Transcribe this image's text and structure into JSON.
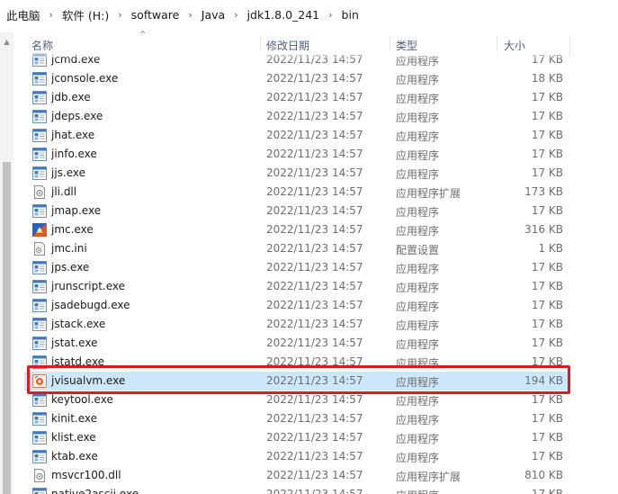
{
  "breadcrumb": [
    "此电脑",
    "软件 (H:)",
    "software",
    "Java",
    "jdk1.8.0_241",
    "bin"
  ],
  "columns": {
    "name": "名称",
    "modified": "修改日期",
    "type": "类型",
    "size": "大小"
  },
  "files": [
    {
      "name": "jcmd.exe",
      "date": "2022/11/23 14:57",
      "type": "应用程序",
      "size": "17 KB",
      "icon": "exe-icon"
    },
    {
      "name": "jconsole.exe",
      "date": "2022/11/23 14:57",
      "type": "应用程序",
      "size": "18 KB",
      "icon": "exe-icon"
    },
    {
      "name": "jdb.exe",
      "date": "2022/11/23 14:57",
      "type": "应用程序",
      "size": "17 KB",
      "icon": "exe-icon"
    },
    {
      "name": "jdeps.exe",
      "date": "2022/11/23 14:57",
      "type": "应用程序",
      "size": "17 KB",
      "icon": "exe-icon"
    },
    {
      "name": "jhat.exe",
      "date": "2022/11/23 14:57",
      "type": "应用程序",
      "size": "17 KB",
      "icon": "exe-icon"
    },
    {
      "name": "jinfo.exe",
      "date": "2022/11/23 14:57",
      "type": "应用程序",
      "size": "17 KB",
      "icon": "exe-icon"
    },
    {
      "name": "jjs.exe",
      "date": "2022/11/23 14:57",
      "type": "应用程序",
      "size": "17 KB",
      "icon": "exe-icon"
    },
    {
      "name": "jli.dll",
      "date": "2022/11/23 14:57",
      "type": "应用程序扩展",
      "size": "173 KB",
      "icon": "dll-icon"
    },
    {
      "name": "jmap.exe",
      "date": "2022/11/23 14:57",
      "type": "应用程序",
      "size": "17 KB",
      "icon": "exe-icon"
    },
    {
      "name": "jmc.exe",
      "date": "2022/11/23 14:57",
      "type": "应用程序",
      "size": "316 KB",
      "icon": "jmc-icon"
    },
    {
      "name": "jmc.ini",
      "date": "2022/11/23 14:57",
      "type": "配置设置",
      "size": "1 KB",
      "icon": "ini-icon"
    },
    {
      "name": "jps.exe",
      "date": "2022/11/23 14:57",
      "type": "应用程序",
      "size": "17 KB",
      "icon": "exe-icon"
    },
    {
      "name": "jrunscript.exe",
      "date": "2022/11/23 14:57",
      "type": "应用程序",
      "size": "17 KB",
      "icon": "exe-icon"
    },
    {
      "name": "jsadebugd.exe",
      "date": "2022/11/23 14:57",
      "type": "应用程序",
      "size": "17 KB",
      "icon": "exe-icon"
    },
    {
      "name": "jstack.exe",
      "date": "2022/11/23 14:57",
      "type": "应用程序",
      "size": "17 KB",
      "icon": "exe-icon"
    },
    {
      "name": "jstat.exe",
      "date": "2022/11/23 14:57",
      "type": "应用程序",
      "size": "17 KB",
      "icon": "exe-icon"
    },
    {
      "name": "jstatd.exe",
      "date": "2022/11/23 14:57",
      "type": "应用程序",
      "size": "17 KB",
      "icon": "exe-icon"
    },
    {
      "name": "jvisualvm.exe",
      "date": "2022/11/23 14:57",
      "type": "应用程序",
      "size": "194 KB",
      "icon": "jvisualvm-icon",
      "selected": true
    },
    {
      "name": "keytool.exe",
      "date": "2022/11/23 14:57",
      "type": "应用程序",
      "size": "17 KB",
      "icon": "exe-icon"
    },
    {
      "name": "kinit.exe",
      "date": "2022/11/23 14:57",
      "type": "应用程序",
      "size": "17 KB",
      "icon": "exe-icon"
    },
    {
      "name": "klist.exe",
      "date": "2022/11/23 14:57",
      "type": "应用程序",
      "size": "17 KB",
      "icon": "exe-icon"
    },
    {
      "name": "ktab.exe",
      "date": "2022/11/23 14:57",
      "type": "应用程序",
      "size": "17 KB",
      "icon": "exe-icon"
    },
    {
      "name": "msvcr100.dll",
      "date": "2022/11/23 14:57",
      "type": "应用程序扩展",
      "size": "810 KB",
      "icon": "dll-icon"
    },
    {
      "name": "native2ascii.exe",
      "date": "2022/11/23 14:57",
      "type": "应用程序",
      "size": "17 KB",
      "icon": "exe-icon"
    }
  ],
  "colors": {
    "selection": "#cce8ff",
    "highlight_border": "#e0191f",
    "header_text": "#4d6082"
  }
}
